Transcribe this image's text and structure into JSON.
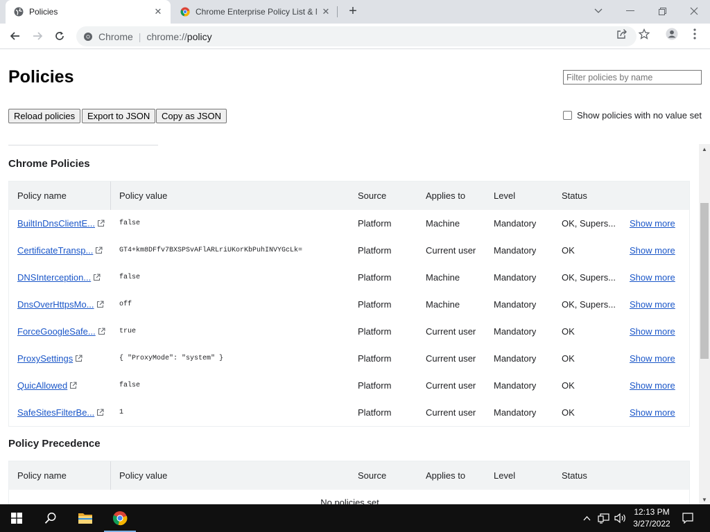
{
  "tabs": [
    {
      "title": "Policies",
      "icon": "gear-icon",
      "active": true
    },
    {
      "title": "Chrome Enterprise Policy List & M",
      "icon": "chrome-icon",
      "active": false
    }
  ],
  "toolbar": {
    "site_label": "Chrome",
    "url_scheme": "chrome://",
    "url_host": "policy"
  },
  "page": {
    "title": "Policies",
    "filter_placeholder": "Filter policies by name",
    "buttons": {
      "reload": "Reload policies",
      "export": "Export to JSON",
      "copy": "Copy as JSON"
    },
    "show_no_value_label": "Show policies with no value set"
  },
  "table_headers": [
    "Policy name",
    "Policy value",
    "Source",
    "Applies to",
    "Level",
    "Status"
  ],
  "chrome_policies": {
    "title": "Chrome Policies",
    "rows": [
      {
        "name": "BuiltInDnsClientE...",
        "value": "false",
        "source": "Platform",
        "applies": "Machine",
        "level": "Mandatory",
        "status": "OK, Supers...",
        "more": "Show more"
      },
      {
        "name": "CertificateTransp...",
        "value": "GT4+km8DFfv7BXSPSvAFlARLriUKorKbPuhINVYGcLk=",
        "source": "Platform",
        "applies": "Current user",
        "level": "Mandatory",
        "status": "OK",
        "more": "Show more"
      },
      {
        "name": "DNSInterception...",
        "value": "false",
        "source": "Platform",
        "applies": "Machine",
        "level": "Mandatory",
        "status": "OK, Supers...",
        "more": "Show more"
      },
      {
        "name": "DnsOverHttpsMo...",
        "value": "off",
        "source": "Platform",
        "applies": "Machine",
        "level": "Mandatory",
        "status": "OK, Supers...",
        "more": "Show more"
      },
      {
        "name": "ForceGoogleSafe...",
        "value": "true",
        "source": "Platform",
        "applies": "Current user",
        "level": "Mandatory",
        "status": "OK",
        "more": "Show more"
      },
      {
        "name": "ProxySettings",
        "value": "{ \"ProxyMode\": \"system\" }",
        "source": "Platform",
        "applies": "Current user",
        "level": "Mandatory",
        "status": "OK",
        "more": "Show more"
      },
      {
        "name": "QuicAllowed",
        "value": "false",
        "source": "Platform",
        "applies": "Current user",
        "level": "Mandatory",
        "status": "OK",
        "more": "Show more"
      },
      {
        "name": "SafeSitesFilterBe...",
        "value": "1",
        "source": "Platform",
        "applies": "Current user",
        "level": "Mandatory",
        "status": "OK",
        "more": "Show more"
      }
    ]
  },
  "policy_precedence": {
    "title": "Policy Precedence",
    "empty_text": "No policies set"
  },
  "taskbar": {
    "time": "12:13 PM",
    "date": "3/27/2022"
  }
}
